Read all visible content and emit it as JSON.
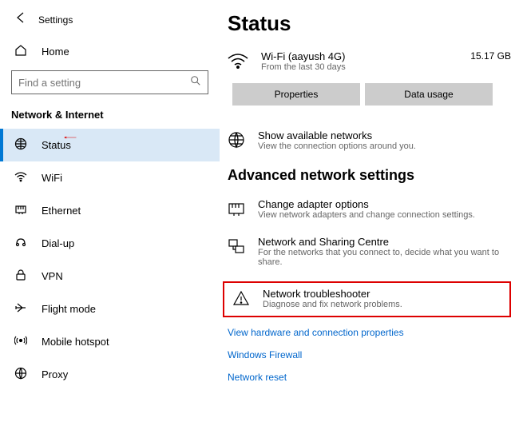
{
  "header": {
    "title": "Settings"
  },
  "sidebar": {
    "home": "Home",
    "search_placeholder": "Find a setting",
    "section": "Network & Internet",
    "items": [
      {
        "label": "Status"
      },
      {
        "label": "WiFi"
      },
      {
        "label": "Ethernet"
      },
      {
        "label": "Dial-up"
      },
      {
        "label": "VPN"
      },
      {
        "label": "Flight mode"
      },
      {
        "label": "Mobile hotspot"
      },
      {
        "label": "Proxy"
      }
    ]
  },
  "main": {
    "title": "Status",
    "wifi": {
      "name": "Wi-Fi (aayush 4G)",
      "sub": "From the last 30 days",
      "usage": "15.17 GB"
    },
    "buttons": {
      "properties": "Properties",
      "data_usage": "Data usage"
    },
    "show_networks": {
      "title": "Show available networks",
      "sub": "View the connection options around you."
    },
    "advanced_heading": "Advanced network settings",
    "adapter": {
      "title": "Change adapter options",
      "sub": "View network adapters and change connection settings."
    },
    "sharing": {
      "title": "Network and Sharing Centre",
      "sub": "For the networks that you connect to, decide what you want to share."
    },
    "troubleshooter": {
      "title": "Network troubleshooter",
      "sub": "Diagnose and fix network problems."
    },
    "links": {
      "hardware": "View hardware and connection properties",
      "firewall": "Windows Firewall",
      "reset": "Network reset"
    }
  }
}
